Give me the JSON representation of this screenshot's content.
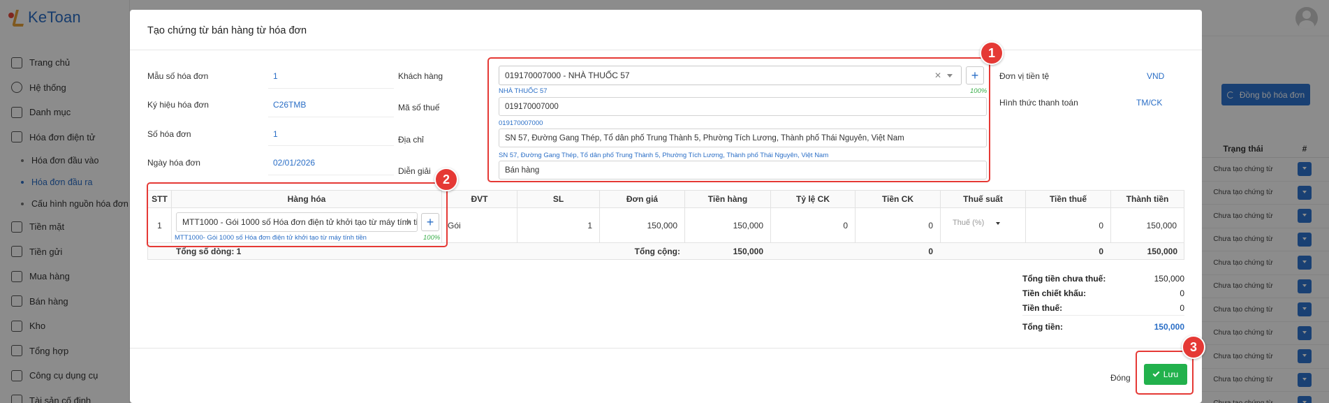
{
  "app": {
    "logo_text": "KeToan",
    "sidebar": {
      "items": [
        {
          "label": "Trang chủ",
          "icon": "home-icon"
        },
        {
          "label": "Hệ thống",
          "icon": "gear-icon"
        },
        {
          "label": "Danh mục",
          "icon": "grid-icon"
        },
        {
          "label": "Hóa đơn điện tử",
          "icon": "invoice-icon"
        }
      ],
      "sub_items": [
        {
          "label": "Hóa đơn đầu vào",
          "active": false
        },
        {
          "label": "Hóa đơn đầu ra",
          "active": true
        },
        {
          "label": "Cấu hình nguồn hóa đơn",
          "active": false
        }
      ],
      "items_after": [
        {
          "label": "Tiền mặt",
          "icon": "cash-icon"
        },
        {
          "label": "Tiền gửi",
          "icon": "bank-icon"
        },
        {
          "label": "Mua hàng",
          "icon": "cart-icon"
        },
        {
          "label": "Bán hàng",
          "icon": "sales-icon"
        },
        {
          "label": "Kho",
          "icon": "warehouse-icon"
        },
        {
          "label": "Tổng hợp",
          "icon": "chart-icon"
        },
        {
          "label": "Công cụ dụng cụ",
          "icon": "tools-icon"
        },
        {
          "label": "Tài sản cố định",
          "icon": "asset-icon"
        }
      ]
    },
    "sync_button_label": "Đồng bộ hóa đơn",
    "bg_table": {
      "headers": [
        "Trạng thái",
        "#"
      ],
      "rows": [
        "Chưa tạo chứng từ",
        "Chưa tạo chứng từ",
        "Chưa tạo chứng từ",
        "Chưa tạo chứng từ",
        "Chưa tạo chứng từ",
        "Chưa tạo chứng từ",
        "Chưa tạo chứng từ",
        "Chưa tạo chứng từ",
        "Chưa tạo chứng từ",
        "Chưa tạo chứng từ",
        "Chưa tạo chứng từ"
      ]
    }
  },
  "modal": {
    "title": "Tạo chứng từ bán hàng từ hóa đơn",
    "invoice": {
      "form_no_label": "Mẫu số hóa đơn",
      "form_no": "1",
      "symbol_label": "Ký hiệu hóa đơn",
      "symbol": "C26TMB",
      "number_label": "Số hóa đơn",
      "number": "1",
      "date_label": "Ngày hóa đơn",
      "date": "02/01/2026"
    },
    "customer": {
      "label": "Khách hàng",
      "value": "019170007000 - NHÀ THUỐC 57",
      "hint": "NHÀ THUỐC 57",
      "match_pct": "100%",
      "tax_label": "Mã số thuế",
      "tax_value": "019170007000",
      "tax_hint": "019170007000",
      "address_label": "Địa chỉ",
      "address_value": "SN 57, Đường Gang Thép, Tổ dân phố Trung Thành 5, Phường Tích Lương, Thành phố Thái Nguyên, Việt Nam",
      "address_hint": "SN 57, Đường Gang Thép, Tổ dân phố Trung Thành 5, Phường Tích Lương, Thành phố Thái Nguyên, Việt Nam",
      "desc_label": "Diễn giải",
      "desc_value": "Bán hàng"
    },
    "currency": {
      "label": "Đơn vị tiền tệ",
      "value": "VND"
    },
    "payment": {
      "label": "Hình thức thanh toán",
      "value": "TM/CK"
    },
    "grid": {
      "headers": [
        "STT",
        "Hàng hóa",
        "ĐVT",
        "SL",
        "Đơn giá",
        "Tiền hàng",
        "Tỷ lệ CK",
        "Tiền CK",
        "Thuế suất",
        "Tiền thuế",
        "Thành tiền"
      ],
      "row": {
        "stt": "1",
        "item": "MTT1000 - Gói 1000 số Hóa đơn điện tử khởi tạo từ máy tính tiền",
        "item_hint": "MTT1000- Gói 1000 số Hóa đơn điện tử khởi tạo từ máy tính tiền",
        "item_pct": "100%",
        "unit": "Gói",
        "qty": "1",
        "price": "150,000",
        "amount": "150,000",
        "discount_rate": "0",
        "discount": "0",
        "tax_rate_placeholder": "Thuế (%)",
        "tax": "0",
        "total": "150,000"
      },
      "footer": {
        "row_count": "Tổng số dòng: 1",
        "sum_label": "Tổng cộng:",
        "amount": "150,000",
        "discount": "0",
        "tax": "0",
        "total": "150,000"
      }
    },
    "totals": {
      "pretax_label": "Tổng tiền chưa thuế:",
      "pretax": "150,000",
      "discount_label": "Tiền chiết khấu:",
      "discount": "0",
      "tax_label": "Tiền thuế:",
      "tax": "0",
      "total_label": "Tổng tiền:",
      "total": "150,000"
    },
    "buttons": {
      "close": "Đóng",
      "save": "Lưu"
    }
  },
  "annotations": [
    "1",
    "2",
    "3"
  ]
}
